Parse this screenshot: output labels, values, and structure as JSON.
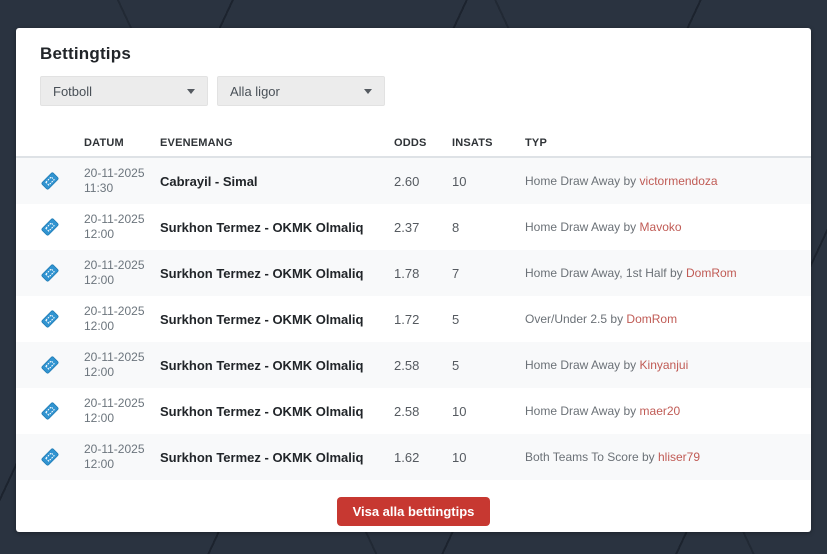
{
  "title": "Bettingtips",
  "filters": {
    "sport": {
      "value": "Fotboll"
    },
    "league": {
      "value": "Alla ligor"
    }
  },
  "table": {
    "headers": {
      "date": "DATUM",
      "event": "EVENEMANG",
      "odds": "ODDS",
      "stake": "INSATS",
      "type": "TYP"
    },
    "by_label": "by",
    "rows": [
      {
        "date": "20-11-2025",
        "time": "11:30",
        "event": "Cabrayil - Simal",
        "odds": "2.60",
        "stake": "10",
        "type": "Home Draw Away",
        "tipster": "victormendoza"
      },
      {
        "date": "20-11-2025",
        "time": "12:00",
        "event": "Surkhon Termez - OKMK Olmaliq",
        "odds": "2.37",
        "stake": "8",
        "type": "Home Draw Away",
        "tipster": "Mavoko"
      },
      {
        "date": "20-11-2025",
        "time": "12:00",
        "event": "Surkhon Termez - OKMK Olmaliq",
        "odds": "1.78",
        "stake": "7",
        "type": "Home Draw Away, 1st Half",
        "tipster": "DomRom"
      },
      {
        "date": "20-11-2025",
        "time": "12:00",
        "event": "Surkhon Termez - OKMK Olmaliq",
        "odds": "1.72",
        "stake": "5",
        "type": "Over/Under 2.5",
        "tipster": "DomRom"
      },
      {
        "date": "20-11-2025",
        "time": "12:00",
        "event": "Surkhon Termez - OKMK Olmaliq",
        "odds": "2.58",
        "stake": "5",
        "type": "Home Draw Away",
        "tipster": "Kinyanjui"
      },
      {
        "date": "20-11-2025",
        "time": "12:00",
        "event": "Surkhon Termez - OKMK Olmaliq",
        "odds": "2.58",
        "stake": "10",
        "type": "Home Draw Away",
        "tipster": "maer20"
      },
      {
        "date": "20-11-2025",
        "time": "12:00",
        "event": "Surkhon Termez - OKMK Olmaliq",
        "odds": "1.62",
        "stake": "10",
        "type": "Both Teams To Score",
        "tipster": "hliser79"
      }
    ]
  },
  "footer": {
    "button_label": "Visa alla bettingtips"
  },
  "icons": {
    "row_icon": "ticket-icon",
    "dropdown_icon": "caret-down-icon"
  },
  "colors": {
    "background": "#2a3340",
    "card": "#ffffff",
    "ticket_blue": "#3194d1",
    "tipster_red": "#c05b55",
    "button_red": "#c73831",
    "row_stripe": "#f8f9fa",
    "header_text": "#2f3337",
    "muted_text": "#6c757d"
  }
}
